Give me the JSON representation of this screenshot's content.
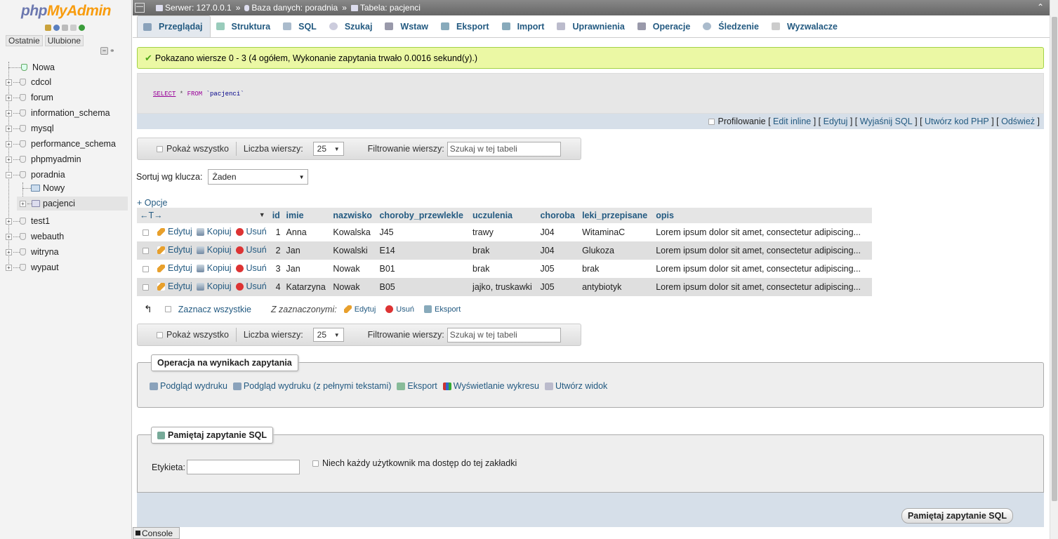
{
  "sidebar": {
    "logo_php": "php",
    "logo_myadmin": "MyAdmin",
    "recent_label": "Ostatnie",
    "favorites_label": "Ulubione",
    "tree": [
      {
        "label": "Nowa",
        "kind": "new"
      },
      {
        "label": "cdcol",
        "kind": "db"
      },
      {
        "label": "forum",
        "kind": "db"
      },
      {
        "label": "information_schema",
        "kind": "db"
      },
      {
        "label": "mysql",
        "kind": "db"
      },
      {
        "label": "performance_schema",
        "kind": "db"
      },
      {
        "label": "phpmyadmin",
        "kind": "db"
      },
      {
        "label": "poradnia",
        "kind": "db-open"
      },
      {
        "label": "Nowy",
        "kind": "child-new"
      },
      {
        "label": "pacjenci",
        "kind": "child-table"
      },
      {
        "label": "test1",
        "kind": "db"
      },
      {
        "label": "webauth",
        "kind": "db"
      },
      {
        "label": "witryna",
        "kind": "db"
      },
      {
        "label": "wypaut",
        "kind": "db"
      }
    ]
  },
  "breadcrumb": {
    "server": "Serwer: 127.0.0.1",
    "database": "Baza danych: poradnia",
    "table": "Tabela: pacjenci",
    "separator": "»"
  },
  "tabs": [
    "Przeglądaj",
    "Struktura",
    "SQL",
    "Szukaj",
    "Wstaw",
    "Eksport",
    "Import",
    "Uprawnienia",
    "Operacje",
    "Śledzenie",
    "Wyzwalacze"
  ],
  "success_message": "Pokazano wiersze 0 - 3 (4 ogółem, Wykonanie zapytania trwało 0.0016 sekund(y).)",
  "sql": {
    "select": "SELECT",
    "rest": " * ",
    "from": "FROM",
    "table": " `pacjenci`"
  },
  "profiling": {
    "label": "Profilowanie",
    "links": [
      "Edit inline",
      "Edytuj",
      "Wyjaśnij SQL",
      "Utwórz kod PHP",
      "Odśwież"
    ]
  },
  "nav": {
    "show_all": "Pokaż wszystko",
    "rows_label": "Liczba wierszy:",
    "rows_value": "25",
    "filter_label": "Filtrowanie wierszy:",
    "filter_placeholder": "Szukaj w tej tabeli"
  },
  "sort": {
    "label": "Sortuj wg klucza:",
    "value": "Żaden"
  },
  "options_link": "+ Opcje",
  "table": {
    "columns": [
      "id",
      "imie",
      "nazwisko",
      "choroby_przewlekle",
      "uczulenia",
      "choroba",
      "leki_przepisane",
      "opis"
    ],
    "actions": {
      "edit": "Edytuj",
      "copy": "Kopiuj",
      "delete": "Usuń"
    },
    "rows": [
      [
        "1",
        "Anna",
        "Kowalska",
        "J45",
        "trawy",
        "J04",
        "WitaminaC",
        "Lorem ipsum dolor sit amet, consectetur adipiscing..."
      ],
      [
        "2",
        "Jan",
        "Kowalski",
        "E14",
        "brak",
        "J04",
        "Glukoza",
        "Lorem ipsum dolor sit amet, consectetur adipiscing..."
      ],
      [
        "3",
        "Jan",
        "Nowak",
        "B01",
        "brak",
        "J05",
        "brak",
        "Lorem ipsum dolor sit amet, consectetur adipiscing..."
      ],
      [
        "4",
        "Katarzyna",
        "Nowak",
        "B05",
        "jajko, truskawki",
        "J05",
        "antybiotyk",
        "Lorem ipsum dolor sit amet, consectetur adipiscing..."
      ]
    ]
  },
  "bulk": {
    "check_all": "Zaznacz wszystkie",
    "with_selected": "Z zaznaczonymi:",
    "edit": "Edytuj",
    "delete": "Usuń",
    "export": "Eksport"
  },
  "query_ops": {
    "title": "Operacja na wynikach zapytania",
    "links": [
      "Podgląd wydruku",
      "Podgląd wydruku (z pełnymi tekstami)",
      "Eksport",
      "Wyświetlanie wykresu",
      "Utwórz widok"
    ]
  },
  "bookmark": {
    "title": "Pamiętaj zapytanie SQL",
    "label": "Etykieta:",
    "shared": "Niech każdy użytkownik ma dostęp do tej zakładki",
    "button": "Pamiętaj zapytanie SQL"
  },
  "console_label": "Console"
}
